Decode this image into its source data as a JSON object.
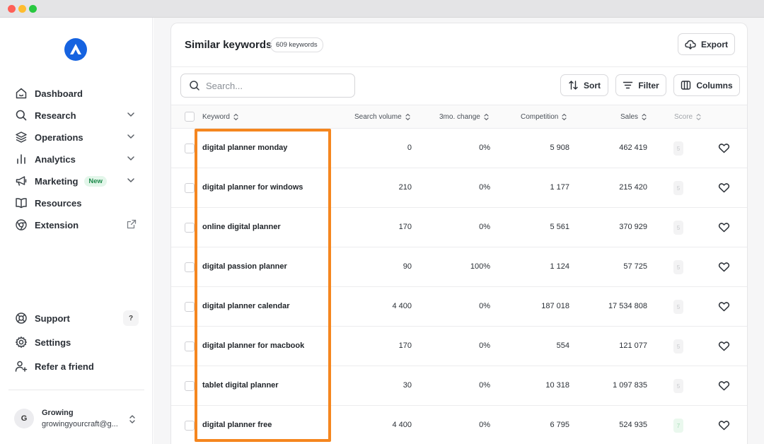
{
  "window": {
    "traffic_lights": [
      "close",
      "minimize",
      "zoom"
    ]
  },
  "sidebar": {
    "logo_icon": "brand-logo-icon",
    "items": [
      {
        "label": "Dashboard",
        "icon": "home-icon",
        "has_chevron": false
      },
      {
        "label": "Research",
        "icon": "search-icon",
        "has_chevron": true
      },
      {
        "label": "Operations",
        "icon": "layers-icon",
        "has_chevron": true
      },
      {
        "label": "Analytics",
        "icon": "bar-chart-icon",
        "has_chevron": true
      },
      {
        "label": "Marketing",
        "icon": "megaphone-icon",
        "has_chevron": true,
        "badge": "New"
      },
      {
        "label": "Resources",
        "icon": "book-icon",
        "has_chevron": false
      },
      {
        "label": "Extension",
        "icon": "chrome-icon",
        "external": true
      }
    ],
    "bottom_items": [
      {
        "label": "Support",
        "icon": "lifebuoy-icon",
        "badge": "?"
      },
      {
        "label": "Settings",
        "icon": "gear-icon"
      },
      {
        "label": "Refer a friend",
        "icon": "user-plus-icon"
      }
    ],
    "user": {
      "initial": "G",
      "name": "Growing",
      "email": "growingyourcraft@g..."
    }
  },
  "main": {
    "title": "Similar keywords",
    "count_badge": "609 keywords",
    "export_label": "Export",
    "search": {
      "placeholder": "Search..."
    },
    "toolbar": {
      "sort_label": "Sort",
      "filter_label": "Filter",
      "columns_label": "Columns"
    },
    "columns": [
      "Keyword",
      "Search volume",
      "3mo. change",
      "Competition",
      "Sales",
      "Score"
    ],
    "rows": [
      {
        "keyword": "digital planner monday",
        "volume": "0",
        "change": "0%",
        "competition": "5 908",
        "sales": "462 419",
        "score": "5"
      },
      {
        "keyword": "digital planner for windows",
        "volume": "210",
        "change": "0%",
        "competition": "1 177",
        "sales": "215 420",
        "score": "5"
      },
      {
        "keyword": "online digital planner",
        "volume": "170",
        "change": "0%",
        "competition": "5 561",
        "sales": "370 929",
        "score": "5"
      },
      {
        "keyword": "digital passion planner",
        "volume": "90",
        "change": "100%",
        "competition": "1 124",
        "sales": "57 725",
        "score": "5"
      },
      {
        "keyword": "digital planner calendar",
        "volume": "4 400",
        "change": "0%",
        "competition": "187 018",
        "sales": "17 534 808",
        "score": "5"
      },
      {
        "keyword": "digital planner for macbook",
        "volume": "170",
        "change": "0%",
        "competition": "554",
        "sales": "121 077",
        "score": "5"
      },
      {
        "keyword": "tablet digital planner",
        "volume": "30",
        "change": "0%",
        "competition": "10 318",
        "sales": "1 097 835",
        "score": "5"
      },
      {
        "keyword": "digital planner free",
        "volume": "4 400",
        "change": "0%",
        "competition": "6 795",
        "sales": "524 935",
        "score": "7"
      }
    ],
    "highlight_color": "#f5861f"
  }
}
